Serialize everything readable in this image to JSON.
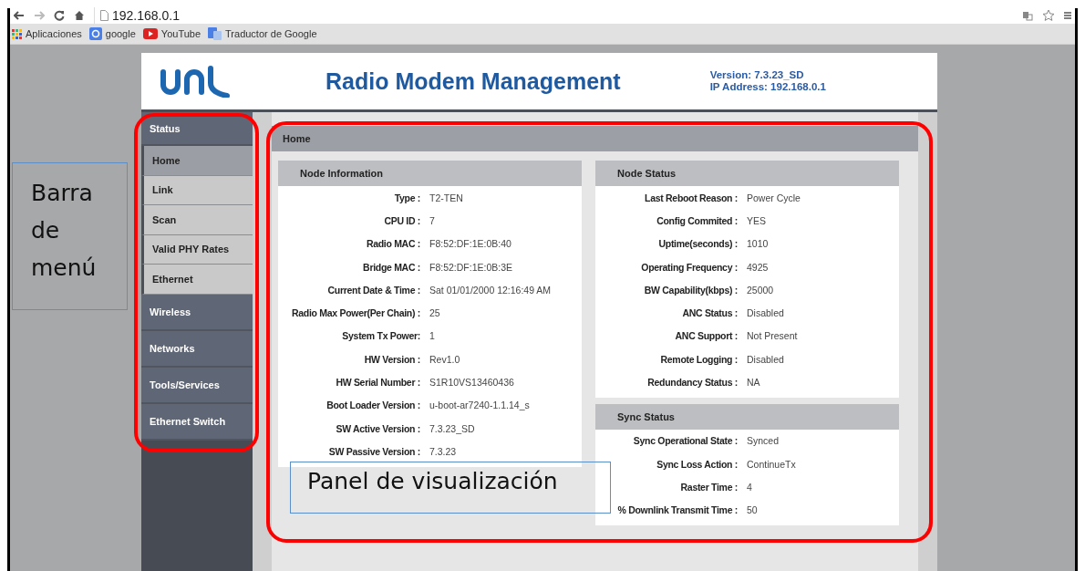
{
  "browser": {
    "address": "192.168.0.1",
    "bookmarks": [
      {
        "kind": "apps",
        "label": "Aplicaciones"
      },
      {
        "kind": "google",
        "label": "google"
      },
      {
        "kind": "youtube",
        "label": "YouTube"
      },
      {
        "kind": "translate",
        "label": "Traductor de Google"
      }
    ]
  },
  "header": {
    "title": "Radio Modem Management",
    "version": "Version: 7.3.23_SD",
    "ip": "IP Address: 192.168.0.1"
  },
  "sidebar": [
    {
      "label": "Status",
      "expanded": true,
      "children": [
        {
          "label": "Home",
          "selected": true
        },
        {
          "label": "Link",
          "selected": false
        },
        {
          "label": "Scan",
          "selected": false
        },
        {
          "label": "Valid PHY Rates",
          "selected": false
        },
        {
          "label": "Ethernet",
          "selected": false
        }
      ]
    },
    {
      "label": "Wireless",
      "expanded": false
    },
    {
      "label": "Networks",
      "expanded": false
    },
    {
      "label": "Tools/Services",
      "expanded": false
    },
    {
      "label": "Ethernet Switch",
      "expanded": false
    }
  ],
  "page_title": "Home",
  "columns": [
    [
      {
        "title": "Node Information",
        "rows": [
          {
            "label": "Type :",
            "value": "T2-TEN"
          },
          {
            "label": "CPU ID :",
            "value": "7"
          },
          {
            "label": "Radio MAC :",
            "value": "F8:52:DF:1E:0B:40"
          },
          {
            "label": "Bridge MAC :",
            "value": "F8:52:DF:1E:0B:3E"
          },
          {
            "label": "Current Date & Time :",
            "value": "Sat 01/01/2000 12:16:49 AM"
          },
          {
            "label": "Radio Max Power(Per Chain) :",
            "value": "25"
          },
          {
            "label": "System Tx Power:",
            "value": "1"
          },
          {
            "label": "HW Version :",
            "value": "Rev1.0"
          },
          {
            "label": "HW Serial Number :",
            "value": "S1R10VS13460436"
          },
          {
            "label": "Boot Loader Version :",
            "value": "u-boot-ar7240-1.1.14_s"
          },
          {
            "label": "SW Active Version :",
            "value": "7.3.23_SD"
          },
          {
            "label": "SW Passive Version :",
            "value": "7.3.23"
          }
        ]
      }
    ],
    [
      {
        "title": "Node Status",
        "rows": [
          {
            "label": "Last Reboot Reason :",
            "value": "Power Cycle"
          },
          {
            "label": "Config Commited :",
            "value": "YES"
          },
          {
            "label": "Uptime(seconds) :",
            "value": "1010"
          },
          {
            "label": "Operating Frequency :",
            "value": "4925"
          },
          {
            "label": "BW Capability(kbps) :",
            "value": "25000"
          },
          {
            "label": "ANC Status :",
            "value": "Disabled"
          },
          {
            "label": "ANC Support :",
            "value": "Not Present"
          },
          {
            "label": "Remote Logging :",
            "value": "Disabled"
          },
          {
            "label": "Redundancy Status :",
            "value": "NA"
          }
        ]
      },
      {
        "title": "Sync Status",
        "rows": [
          {
            "label": "Sync Operational State :",
            "value": "Synced"
          },
          {
            "label": "Sync Loss Action :",
            "value": "ContinueTx"
          },
          {
            "label": "Raster Time :",
            "value": "4"
          },
          {
            "label": "% Downlink Transmit Time :",
            "value": "50"
          }
        ]
      }
    ]
  ],
  "annotations": [
    {
      "text": "Barra de menú"
    },
    {
      "text": "Panel de visualización"
    }
  ]
}
